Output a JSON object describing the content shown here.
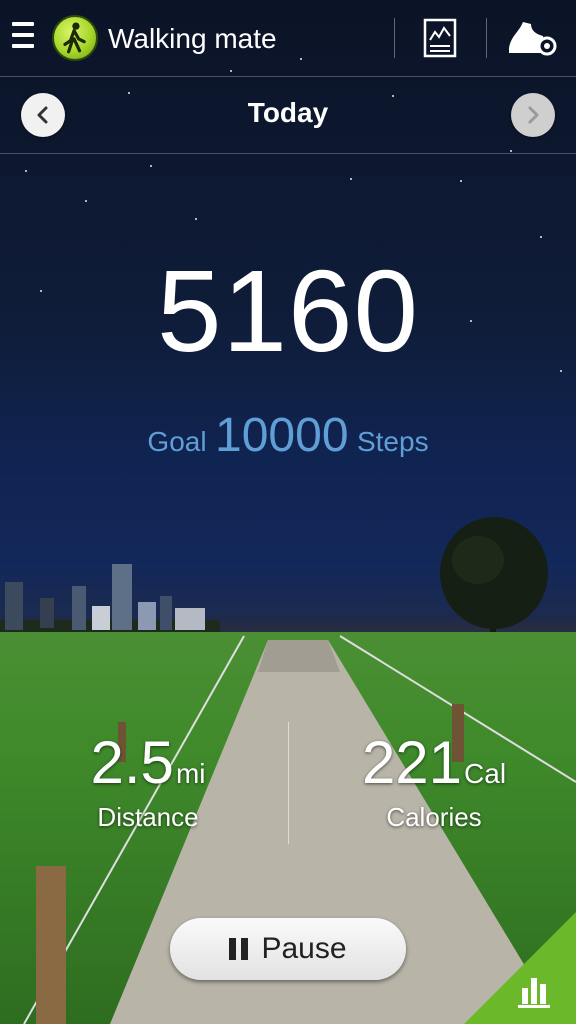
{
  "app": {
    "title": "Walking mate"
  },
  "date_bar": {
    "title": "Today"
  },
  "steps": {
    "count": "5160",
    "goal_label": "Goal",
    "goal_value": "10000",
    "goal_unit": "Steps"
  },
  "stats": {
    "distance": {
      "value": "2.5",
      "unit": "mi",
      "label": "Distance"
    },
    "calories": {
      "value": "221",
      "unit": "Cal",
      "label": "Calories"
    }
  },
  "pause_button": {
    "label": "Pause"
  },
  "icons": [
    "menu-icon",
    "walking-person-icon",
    "chart-document-icon",
    "shoe-settings-icon",
    "chevron-left-icon",
    "chevron-right-icon",
    "pause-icon",
    "bar-chart-icon"
  ],
  "colors": {
    "accent_blue": "#5f9fd6",
    "app_icon_green": "#a6d62c",
    "corner_green": "#6bb82a"
  }
}
